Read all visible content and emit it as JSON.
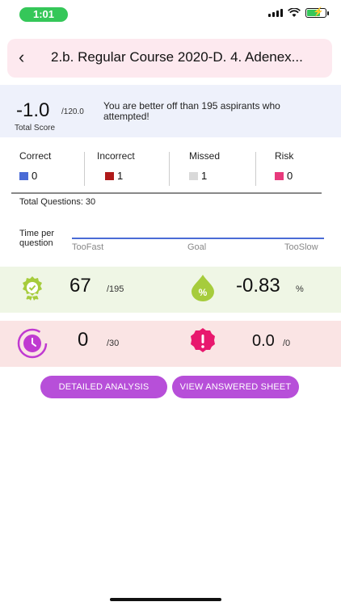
{
  "status": {
    "time": "1:01"
  },
  "header": {
    "title": "2.b. Regular Course 2020-D. 4. Adenex..."
  },
  "score": {
    "value": "-1.0",
    "max": "/120.0",
    "label": "Total Score",
    "message": "You are better off than 195 aspirants who attempted!"
  },
  "stats": [
    {
      "label": "Correct",
      "value": "0",
      "color": "#4a6bd6"
    },
    {
      "label": "Incorrect",
      "value": "1",
      "color": "#b01a1a"
    },
    {
      "label": "Missed",
      "value": "1",
      "color": "#d9d9d9"
    },
    {
      "label": "Risk",
      "value": "0",
      "color": "#e83a7c"
    }
  ],
  "total_questions": "Total Questions: 30",
  "time_per_question": {
    "label": "Time per question",
    "too_fast": "TooFast",
    "goal": "Goal",
    "too_slow": "TooSlow"
  },
  "metrics": {
    "rank": {
      "value": "67",
      "sub": "/195",
      "icon": "badge-icon",
      "color": "#a6cc3c"
    },
    "percentile": {
      "value": "-0.83",
      "sub": "%",
      "icon": "percent-drop-icon",
      "color": "#a6cc3c"
    },
    "time": {
      "value": "0",
      "sub": "/30",
      "icon": "clock-icon",
      "color": "#c03ad1"
    },
    "risk": {
      "value": "0.0",
      "sub": "/0",
      "icon": "alert-icon",
      "color": "#e8186e"
    }
  },
  "buttons": {
    "analysis": "DETAILED ANALYSIS",
    "answered_sheet": "VIEW ANSWERED SHEET"
  }
}
